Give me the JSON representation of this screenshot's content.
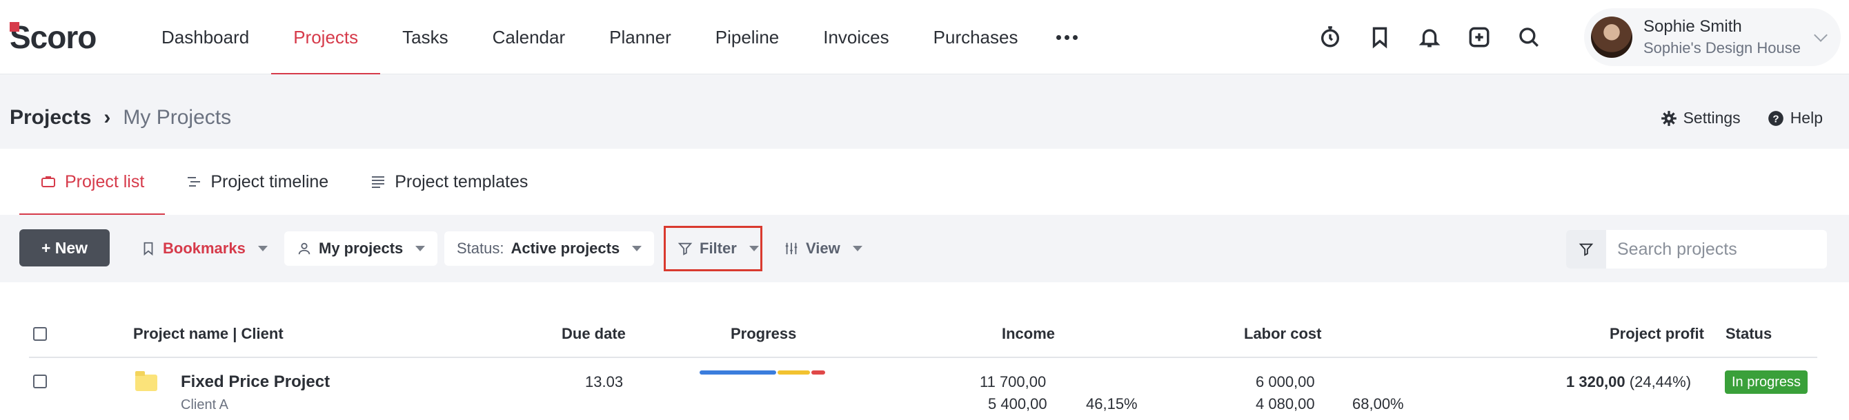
{
  "app": {
    "logo_text": "Scoro",
    "brand_color": "#d63a4a"
  },
  "nav": {
    "items": [
      {
        "label": "Dashboard"
      },
      {
        "label": "Projects"
      },
      {
        "label": "Tasks"
      },
      {
        "label": "Calendar"
      },
      {
        "label": "Planner"
      },
      {
        "label": "Pipeline"
      },
      {
        "label": "Invoices"
      },
      {
        "label": "Purchases"
      }
    ],
    "active": "Projects",
    "icons": [
      "timer-icon",
      "bookmark-icon",
      "bell-icon",
      "add-square-icon",
      "search-icon"
    ]
  },
  "user": {
    "name": "Sophie Smith",
    "company": "Sophie's Design House"
  },
  "page": {
    "breadcrumb_root": "Projects",
    "breadcrumb_separator": "›",
    "breadcrumb_current": "My Projects",
    "settings_label": "Settings",
    "help_label": "Help"
  },
  "tabs": [
    {
      "label": "Project list",
      "icon": "briefcase-icon",
      "active": true
    },
    {
      "label": "Project timeline",
      "icon": "timeline-icon",
      "active": false
    },
    {
      "label": "Project templates",
      "icon": "templates-icon",
      "active": false
    }
  ],
  "toolbar": {
    "new_label": "+ New",
    "bookmarks_label": "Bookmarks",
    "my_projects_label": "My projects",
    "status_prefix": "Status:",
    "status_value": "Active projects",
    "filter_label": "Filter",
    "view_label": "View",
    "search_placeholder": "Search projects"
  },
  "table": {
    "headers": {
      "project_name": "Project name | Client",
      "due_date": "Due date",
      "progress": "Progress",
      "income": "Income",
      "labor_cost": "Labor cost",
      "project_profit": "Project profit",
      "status": "Status"
    },
    "rows": [
      {
        "name": "Fixed Price Project",
        "client": "Client A",
        "due_date": "13.03",
        "progress_segments": [
          {
            "color": "#3b7ddd",
            "fraction": 0.62
          },
          {
            "color": "#f2c230",
            "fraction": 0.27
          },
          {
            "color": "#e04848",
            "fraction": 0.11
          }
        ],
        "income_planned": "11 700,00",
        "income_actual": "5 400,00",
        "income_pct": "46,15%",
        "labor_planned": "6 000,00",
        "labor_actual": "4 080,00",
        "labor_pct": "68,00%",
        "profit": "1 320,00",
        "profit_pct": "(24,44%)",
        "status": "In progress",
        "status_color": "#3aa03a"
      }
    ]
  }
}
